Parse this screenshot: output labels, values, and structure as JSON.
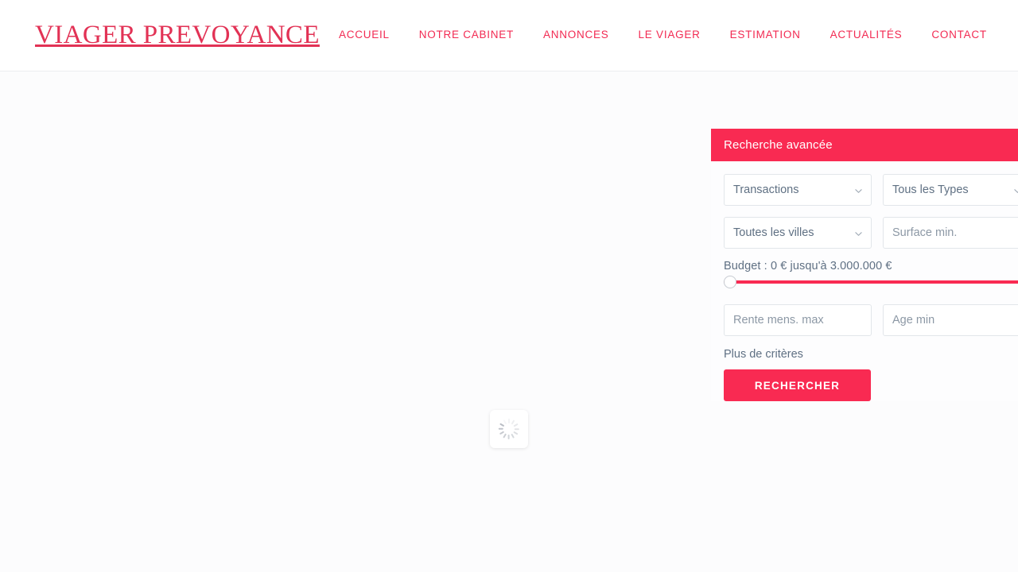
{
  "header": {
    "logo": "VIAGER PREVOYANCE",
    "nav": [
      {
        "label": "ACCUEIL"
      },
      {
        "label": "NOTRE CABINET"
      },
      {
        "label": "ANNONCES"
      },
      {
        "label": "LE VIAGER"
      },
      {
        "label": "ESTIMATION"
      },
      {
        "label": "ACTUALITÉS"
      },
      {
        "label": "CONTACT"
      }
    ]
  },
  "main": {
    "loader": {
      "icon": "spinner-icon",
      "state": "loading"
    }
  },
  "search_panel": {
    "title": "Recherche avancée",
    "fields": {
      "transactions": {
        "value": "Transactions",
        "icon": "chevron-down-icon"
      },
      "types": {
        "value": "Tous les Types",
        "icon": "chevron-down-icon"
      },
      "cities": {
        "value": "Toutes les villes",
        "icon": "chevron-down-icon"
      },
      "surface_min": {
        "placeholder": "Surface min.",
        "value": ""
      },
      "rente_max": {
        "placeholder": "Rente mens. max",
        "value": ""
      },
      "age_min": {
        "placeholder": "Age min",
        "value": ""
      }
    },
    "budget": {
      "label": "Budget : 0 € jusqu'à 3.000.000 €",
      "min": "0 €",
      "max": "3.000.000 €",
      "handle_position_percent": 0
    },
    "more_criteria_label": "Plus de critères",
    "submit_label": "RECHERCHER"
  },
  "colors": {
    "accent": "#f92a52",
    "logo": "#e23255",
    "text": "#5f7083",
    "placeholder": "#8c98a5",
    "border": "#e2e6ea",
    "page_bg": "#fcfcfd"
  }
}
